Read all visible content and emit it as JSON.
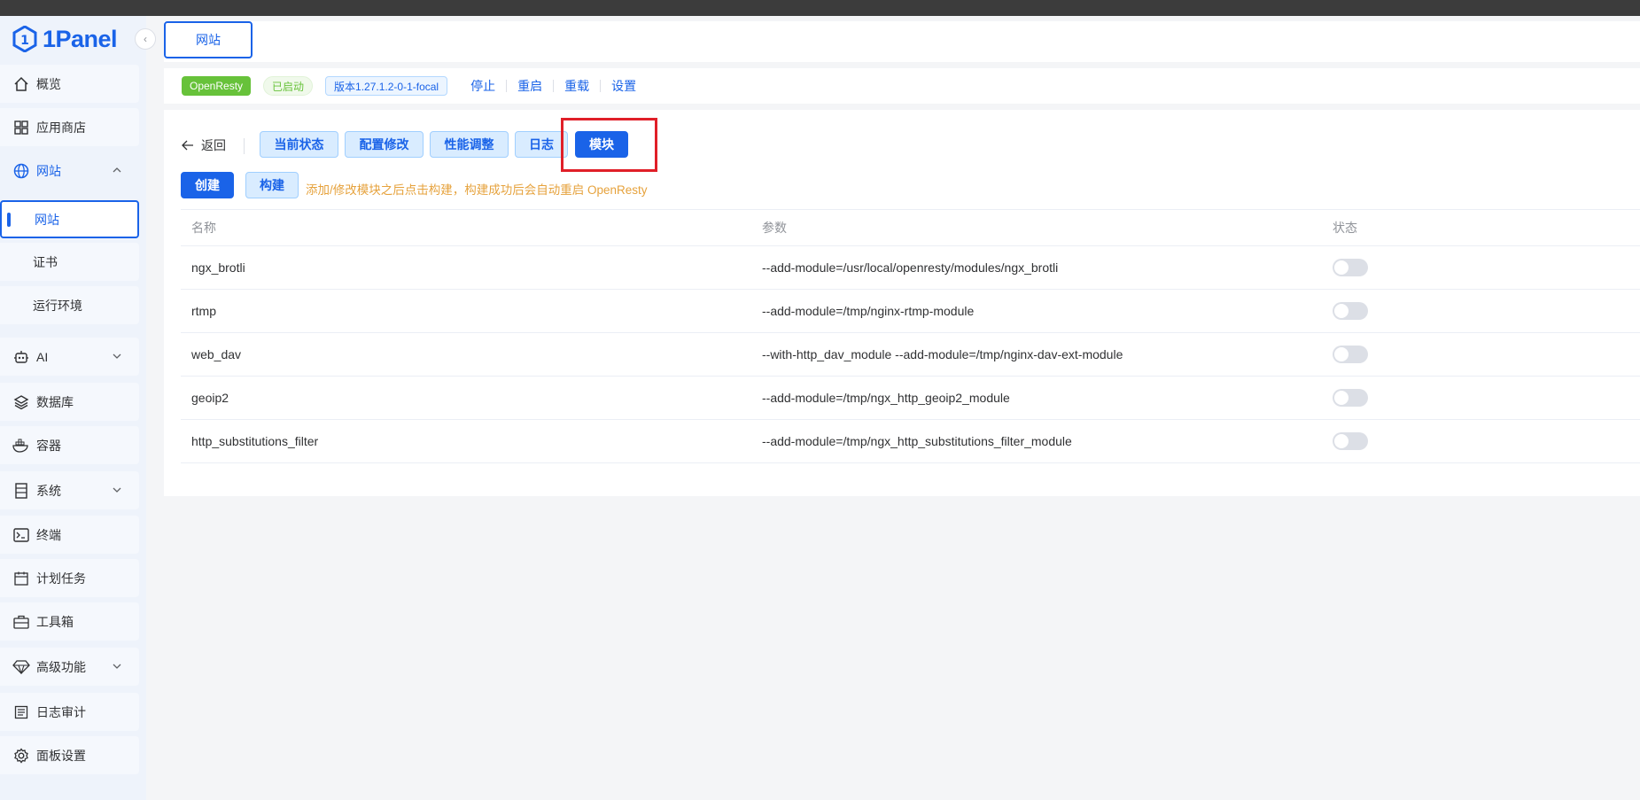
{
  "app": {
    "logo_text": "1Panel"
  },
  "sidebar": {
    "items": [
      {
        "label": "概览",
        "icon": "home-icon"
      },
      {
        "label": "应用商店",
        "icon": "grid-icon"
      },
      {
        "label": "网站",
        "icon": "globe-icon",
        "expanded": true
      },
      {
        "label": "网站",
        "active": true
      },
      {
        "label": "证书"
      },
      {
        "label": "运行环境"
      },
      {
        "label": "AI",
        "icon": "robot-icon"
      },
      {
        "label": "数据库",
        "icon": "layers-icon"
      },
      {
        "label": "容器",
        "icon": "docker-icon"
      },
      {
        "label": "系统",
        "icon": "server-icon"
      },
      {
        "label": "终端",
        "icon": "terminal-icon"
      },
      {
        "label": "计划任务",
        "icon": "calendar-icon"
      },
      {
        "label": "工具箱",
        "icon": "toolbox-icon"
      },
      {
        "label": "高级功能",
        "icon": "diamond-icon"
      },
      {
        "label": "日志审计",
        "icon": "log-icon"
      },
      {
        "label": "面板设置",
        "icon": "gear-icon"
      }
    ]
  },
  "tabbar": {
    "tab_label": "网站"
  },
  "status": {
    "app_tag": "OpenResty",
    "state_tag": "已启动",
    "version_tag": "版本1.27.1.2-0-1-focal",
    "actions": [
      "停止",
      "重启",
      "重载",
      "设置"
    ]
  },
  "toolbar": {
    "back_label": "返回",
    "tabs": [
      "当前状态",
      "配置修改",
      "性能调整",
      "日志",
      "模块"
    ],
    "create_label": "创建",
    "build_label": "构建",
    "hint": "添加/修改模块之后点击构建，构建成功后会自动重启 OpenResty"
  },
  "table": {
    "headers": [
      "名称",
      "参数",
      "状态"
    ],
    "rows": [
      {
        "name": "ngx_brotli",
        "params": "--add-module=/usr/local/openresty/modules/ngx_brotli",
        "enabled": false
      },
      {
        "name": "rtmp",
        "params": "--add-module=/tmp/nginx-rtmp-module",
        "enabled": false
      },
      {
        "name": "web_dav",
        "params": "--with-http_dav_module --add-module=/tmp/nginx-dav-ext-module",
        "enabled": false
      },
      {
        "name": "geoip2",
        "params": "--add-module=/tmp/ngx_http_geoip2_module",
        "enabled": false
      },
      {
        "name": "http_substitutions_filter",
        "params": "--add-module=/tmp/ngx_http_substitutions_filter_module",
        "enabled": false
      }
    ]
  },
  "colors": {
    "primary": "#1a63e8",
    "success": "#67c23a",
    "warning": "#e6a23c",
    "highlight": "#e01f28"
  }
}
